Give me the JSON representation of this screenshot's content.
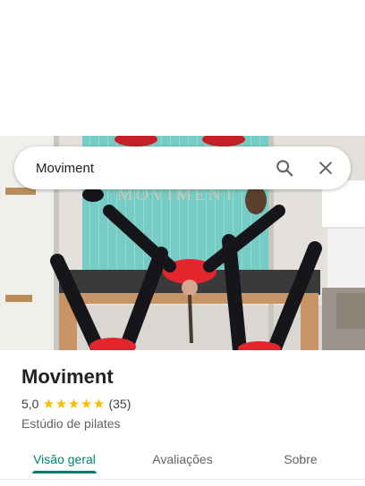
{
  "search": {
    "value": "Moviment",
    "search_icon": "search-icon",
    "clear_icon": "close-icon"
  },
  "photo": {
    "sign_text": "MOVIMENT"
  },
  "place": {
    "name": "Moviment",
    "rating": "5,0",
    "stars": 5,
    "review_count": "(35)",
    "category": "Estúdio de pilates"
  },
  "tabs": [
    {
      "label": "Visão geral",
      "active": true
    },
    {
      "label": "Avaliações",
      "active": false
    },
    {
      "label": "Sobre",
      "active": false
    }
  ],
  "colors": {
    "accent": "#00806e",
    "star": "#fbbc04",
    "text_primary": "#202124",
    "text_secondary": "#5f6368"
  }
}
